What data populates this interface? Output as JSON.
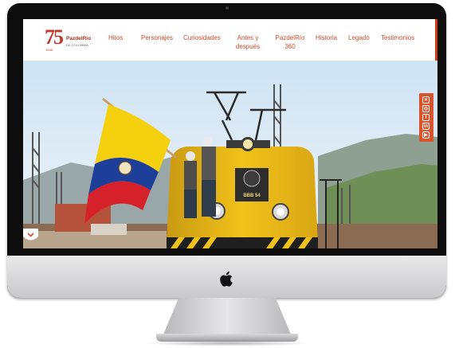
{
  "nav": {
    "items": [
      "Hitos",
      "Personajes",
      "Curiosidades",
      "Antes y",
      "después",
      "PazdelRío",
      "360",
      "Historia",
      "Legado",
      "Testimonios"
    ]
  },
  "logo": {
    "number": "75",
    "brand": "PazdelRío",
    "subtitle": "DE COLOMBIA",
    "year": "1948"
  },
  "locomotive": {
    "plate": "BBB 54"
  },
  "social": {
    "icons": [
      "x-twitter-icon",
      "instagram-icon",
      "facebook-icon",
      "linkedin-icon",
      "youtube-icon"
    ]
  },
  "colors": {
    "accent": "#d24a2c",
    "brand_red": "#c0392b"
  }
}
